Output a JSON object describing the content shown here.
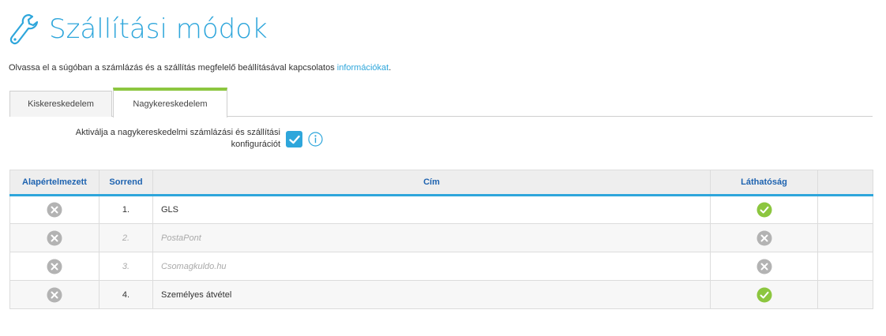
{
  "header": {
    "title": "Szállítási módok",
    "icon": "wrench-icon"
  },
  "info": {
    "text": "Olvassa el a súgóban a számlázás és a szállítás megfelelő beállításával kapcsolatos ",
    "link": "információkat",
    "suffix": "."
  },
  "tabs": [
    {
      "label": "Kiskereskedelem",
      "active": false
    },
    {
      "label": "Nagykereskedelem",
      "active": true
    }
  ],
  "activate": {
    "label_line1": "Aktiválja a nagykereskedelmi számlázási és szállítási",
    "label_line2": "konfigurációt",
    "checked": true
  },
  "table": {
    "headers": [
      "Alapértelmezett",
      "Sorrend",
      "Cím",
      "Láthatóság",
      ""
    ],
    "rows": [
      {
        "default": false,
        "order": "1.",
        "title": "GLS",
        "visible": true,
        "muted": false
      },
      {
        "default": false,
        "order": "2.",
        "title": "PostaPont",
        "visible": false,
        "muted": true
      },
      {
        "default": false,
        "order": "3.",
        "title": "Csomagkuldo.hu",
        "visible": false,
        "muted": true
      },
      {
        "default": false,
        "order": "4.",
        "title": "Személyes átvétel",
        "visible": true,
        "muted": false
      }
    ]
  },
  "colors": {
    "accent": "#2ea6db",
    "tab_active": "#8cc63f",
    "header_text": "#1e63b0",
    "ok": "#8cc63f",
    "off": "#b3b3b3"
  }
}
